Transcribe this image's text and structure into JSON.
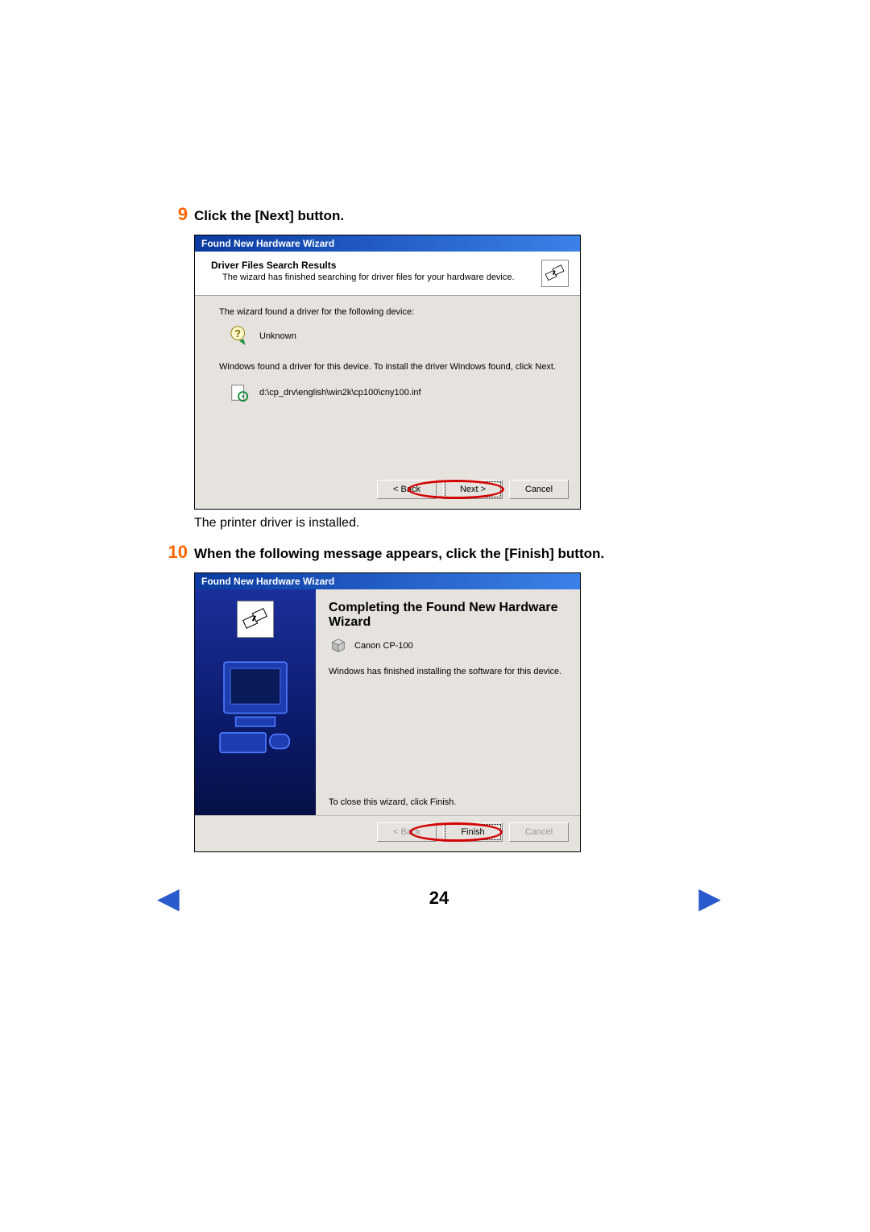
{
  "step9": {
    "num": "9",
    "title": "Click the [Next] button.",
    "dialog": {
      "title": "Found New Hardware Wizard",
      "header_bold": "Driver Files Search Results",
      "header_sub": "The wizard has finished searching for driver files for your hardware device.",
      "body_line1": "The wizard found a driver for the following device:",
      "device_name": "Unknown",
      "body_line2": "Windows found a driver for this device. To install the driver Windows found, click Next.",
      "driver_path": "d:\\cp_drv\\english\\win2k\\cp100\\cny100.inf",
      "btn_back": "< Back",
      "btn_next": "Next >",
      "btn_cancel": "Cancel"
    },
    "after": "The printer driver is installed."
  },
  "step10": {
    "num": "10",
    "title": "When the following message appears, click the [Finish] button.",
    "dialog": {
      "title": "Found New Hardware Wizard",
      "big_title": "Completing the Found New Hardware Wizard",
      "printer_name": "Canon CP-100",
      "body_line": "Windows has finished installing the software for this device.",
      "close_line": "To close this wizard, click Finish.",
      "btn_back": "< Back",
      "btn_finish": "Finish",
      "btn_cancel": "Cancel"
    }
  },
  "page_number": "24"
}
